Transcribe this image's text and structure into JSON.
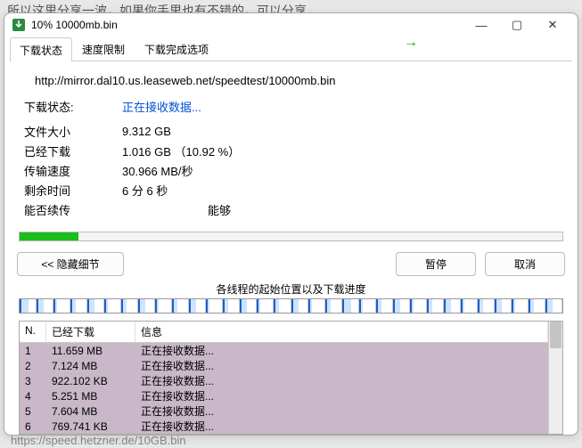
{
  "background_text_top": "所以这里分享一波，如果你手里也有不错的，可以分享",
  "background_link_bottom": "https://speed.hetzner.de/10GB.bin",
  "window_title": "10% 10000mb.bin",
  "accel_indicator": "→",
  "tabs": {
    "status": "下载状态",
    "speed": "速度限制",
    "completion": "下载完成选项"
  },
  "url": "http://mirror.dal10.us.leaseweb.net/speedtest/10000mb.bin",
  "fields": {
    "status_label": "下载状态:",
    "status_value": "正在接收数据...",
    "size_label": "文件大小",
    "size_value": "9.312  GB",
    "downloaded_label": "已经下载",
    "downloaded_value": "1.016  GB （10.92 %）",
    "speed_label": "传输速度",
    "speed_value": "30.966  MB/秒",
    "remaining_label": "剩余时间",
    "remaining_value": "6 分 6 秒",
    "resume_label": "能否续传",
    "resume_value": "能够"
  },
  "progress_percent": 10.9,
  "buttons": {
    "hide": "<< 隐藏细节",
    "pause": "暂停",
    "cancel": "取消"
  },
  "seg_caption": "各线程的起始位置以及下载进度",
  "table": {
    "headers": {
      "n": "N.",
      "dl": "已经下载",
      "info": "信息"
    },
    "rows": [
      {
        "n": "1",
        "dl": "11.659 MB",
        "info": "正在接收数据..."
      },
      {
        "n": "2",
        "dl": "7.124 MB",
        "info": "正在接收数据..."
      },
      {
        "n": "3",
        "dl": "922.102 KB",
        "info": "正在接收数据..."
      },
      {
        "n": "4",
        "dl": "5.251 MB",
        "info": "正在接收数据..."
      },
      {
        "n": "5",
        "dl": "7.604 MB",
        "info": "正在接收数据..."
      },
      {
        "n": "6",
        "dl": "769.741 KB",
        "info": "正在接收数据..."
      }
    ]
  },
  "segments": [
    4,
    3,
    1,
    2,
    3,
    1,
    2,
    3,
    1,
    2,
    3,
    1,
    2,
    3,
    1,
    2,
    3,
    1,
    2,
    4,
    1,
    2,
    3,
    1,
    2,
    3,
    1,
    2,
    3,
    1,
    2,
    3
  ]
}
